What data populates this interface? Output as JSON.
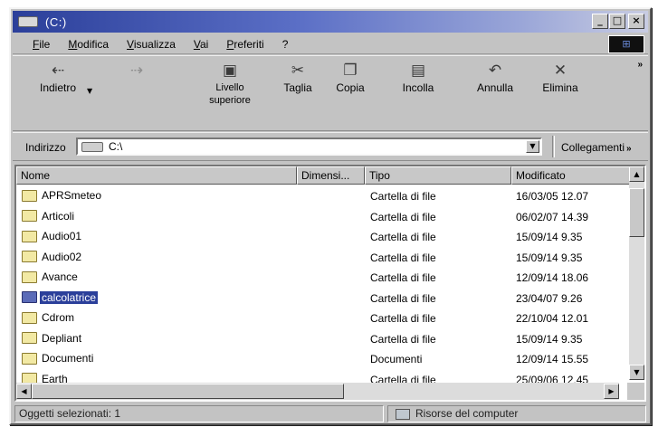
{
  "window": {
    "title": "(C:)"
  },
  "titlebar_buttons": {
    "minimize": "_",
    "maximize": "□",
    "close": "×"
  },
  "menu": {
    "items": [
      "File",
      "Modifica",
      "Visualizza",
      "Vai",
      "Preferiti",
      "?"
    ]
  },
  "toolbar": {
    "back": "Indietro",
    "forward": "",
    "up": "Livello superiore",
    "cut": "Taglia",
    "copy": "Copia",
    "paste": "Incolla",
    "undo": "Annulla",
    "delete": "Elimina",
    "chevron": "»"
  },
  "address": {
    "label": "Indirizzo",
    "value": "C:\\",
    "links": "Collegamenti",
    "links_chevron": "»"
  },
  "columns": [
    "Nome",
    "Dimensi...",
    "Tipo",
    "Modificato"
  ],
  "files": [
    {
      "name": "APRSmeteo",
      "type": "Cartella di file",
      "modified": "16/03/05 12.07"
    },
    {
      "name": "Articoli",
      "type": "Cartella di file",
      "modified": "06/02/07 14.39"
    },
    {
      "name": "Audio01",
      "type": "Cartella di file",
      "modified": "15/09/14 9.35"
    },
    {
      "name": "Audio02",
      "type": "Cartella di file",
      "modified": "15/09/14 9.35"
    },
    {
      "name": "Avance",
      "type": "Cartella di file",
      "modified": "12/09/14 18.06"
    },
    {
      "name": "calcolatrice",
      "type": "Cartella di file",
      "modified": "23/04/07 9.26",
      "selected": true
    },
    {
      "name": "Cdrom",
      "type": "Cartella di file",
      "modified": "22/10/04 12.01"
    },
    {
      "name": "Depliant",
      "type": "Cartella di file",
      "modified": "15/09/14 9.35"
    },
    {
      "name": "Documenti",
      "type": "Documenti",
      "modified": "12/09/14 15.55"
    },
    {
      "name": "Earth",
      "type": "Cartella di file",
      "modified": "25/09/06 12.45"
    }
  ],
  "status": {
    "selection": "Oggetti selezionati: 1",
    "zone": "Risorse del computer"
  },
  "colors": {
    "title_gradient_start": "#2b3f9a",
    "selection": "#2b3f9a",
    "window_face": "#c3c3c3"
  },
  "icons": [
    "folder-icon",
    "drive-icon",
    "computer-icon"
  ]
}
